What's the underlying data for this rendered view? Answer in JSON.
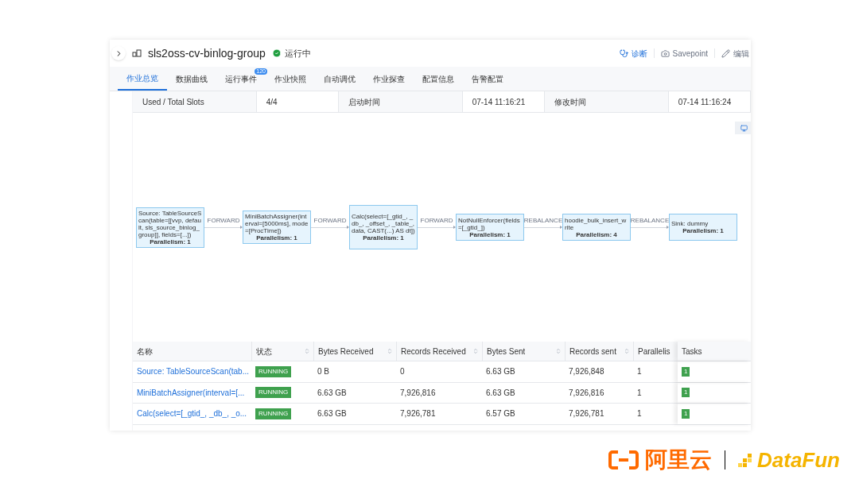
{
  "header": {
    "title": "sls2oss-cv-binlog-group",
    "status": "运行中",
    "actions": [
      {
        "kind": "diagnose",
        "label": "诊断",
        "disabled": false
      },
      {
        "kind": "savepoint",
        "label": "Savepoint",
        "disabled": true
      },
      {
        "kind": "edit",
        "label": "编辑",
        "disabled": true
      }
    ]
  },
  "tabs": [
    {
      "label": "作业总览",
      "selected": true
    },
    {
      "label": "数据曲线",
      "selected": false
    },
    {
      "label": "运行事件",
      "selected": false,
      "badge": "120"
    },
    {
      "label": "作业快照",
      "selected": false
    },
    {
      "label": "自动调优",
      "selected": false
    },
    {
      "label": "作业探查",
      "selected": false
    },
    {
      "label": "配置信息",
      "selected": false
    },
    {
      "label": "告警配置",
      "selected": false
    }
  ],
  "info": [
    {
      "label": "Used / Total Slots",
      "value": "4/4"
    },
    {
      "label": "启动时间",
      "value": "07-14 11:16:21"
    },
    {
      "label": "修改时间",
      "value": "07-14 11:16:24"
    }
  ],
  "graph": {
    "nodes": [
      {
        "text": "Source: TableSourceScan(table=[[vvp, default, sls_source_binlog_group]], fields=[...])",
        "parallelism": "Parallelism: 1"
      },
      {
        "text": "MiniBatchAssigner(interval=[5000ms], mode=[ProcTime])",
        "parallelism": "Parallelism: 1"
      },
      {
        "text": "Calc(select=[_gtid_, _db_, _offset_, _table_, data, CAST(...) AS dt])",
        "parallelism": "Parallelism: 1"
      },
      {
        "text": "NotNullEnforcer(fields=[_gtid_])",
        "parallelism": "Parallelism: 1"
      },
      {
        "text": "hoodie_bulk_insert_write",
        "parallelism": "Parallelism: 4"
      },
      {
        "text": "Sink: dummy",
        "parallelism": "Parallelism: 1"
      }
    ],
    "edges": [
      "FORWARD",
      "FORWARD",
      "FORWARD",
      "REBALANCE",
      "REBALANCE"
    ]
  },
  "table": {
    "columns": [
      {
        "label": "名称",
        "sortable": false
      },
      {
        "label": "状态",
        "sortable": true
      },
      {
        "label": "Bytes Received",
        "sortable": true
      },
      {
        "label": "Records Received",
        "sortable": true
      },
      {
        "label": "Bytes Sent",
        "sortable": true
      },
      {
        "label": "Records sent",
        "sortable": true
      },
      {
        "label": "Parallelis",
        "sortable": false
      },
      {
        "label": "Tasks",
        "sortable": false
      }
    ],
    "rows": [
      {
        "name": "Source: TableSourceScan(tab...",
        "status": "RUNNING",
        "bytes_received": "0 B",
        "records_received": "0",
        "bytes_sent": "6.63 GB",
        "records_sent": "7,926,848",
        "parallelism": "1",
        "tasks": "1"
      },
      {
        "name": "MiniBatchAssigner(interval=[...",
        "status": "RUNNING",
        "bytes_received": "6.63 GB",
        "records_received": "7,926,816",
        "bytes_sent": "6.63 GB",
        "records_sent": "7,926,816",
        "parallelism": "1",
        "tasks": "1"
      },
      {
        "name": "Calc(select=[_gtid_, _db_, _o...",
        "status": "RUNNING",
        "bytes_received": "6.63 GB",
        "records_received": "7,926,781",
        "bytes_sent": "6.57 GB",
        "records_sent": "7,926,781",
        "parallelism": "1",
        "tasks": "1"
      }
    ]
  },
  "footer": {
    "logos": [
      {
        "kind": "aliyun",
        "text": "阿里云"
      },
      {
        "kind": "datafun",
        "text": "DataFun"
      }
    ]
  }
}
